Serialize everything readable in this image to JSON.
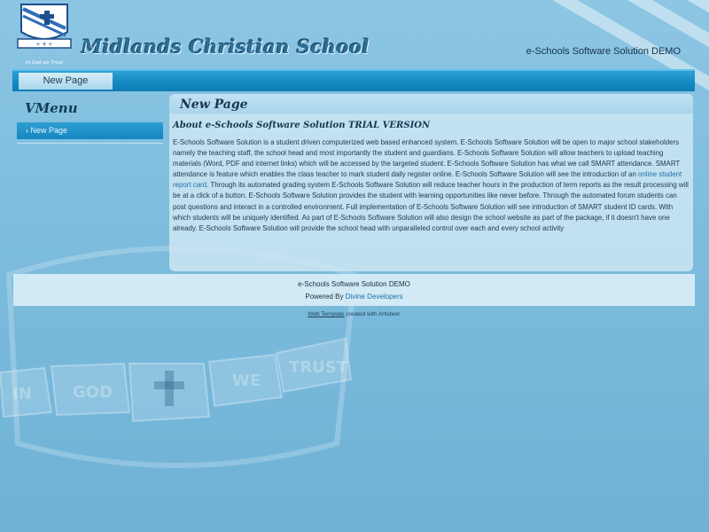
{
  "header": {
    "logo_motto": "In God we Trust",
    "site_title": "Midlands Christian School",
    "right_text": "e-Schools Software Solution DEMO"
  },
  "menubar": {
    "items": [
      {
        "label": "New Page"
      }
    ]
  },
  "vmenu": {
    "title": "VMenu",
    "items": [
      {
        "label": "New Page"
      }
    ]
  },
  "content": {
    "title": "New Page",
    "heading": "About e-Schools Software Solution TRIAL VERSION",
    "text_before_link": "E-Schools Software Solution is a student driven computerized web based enhanced system. E-Schools Software Solution will be open to major school stakeholders namely the teaching staff, the school head and most importantly the student and guardians. E-Schools Software Solution will allow teachers to upload teaching materials (Word, PDF and internet links) which will be accessed by the targeted student. E-Schools Software Solution has what we call SMART attendance. SMART attendance is feature which enables the class teacher to mark student daily register online. E-Schools Software Solution will see the introduction of an ",
    "link_text": "online student report card",
    "text_after_link": ". Through its automated grading system E-Schools Software Solution will reduce teacher hours in the production of term reports as the result processing will be at a click of a button. E-Schools Software Solution provides the student with learning opportunities like never before. Through the automated forum students can post questions and interact in a controlled environment. Full implementation of E-Schools Software Solution will see introduction of SMART student ID cards. With which students will be uniquely identified. As part of E-Schools Software Solution will also design the school website as part of the package, if it doesn't have one  already. E-Schools Software Solution will provide the school head with unparalleled control over each and every school activity"
  },
  "footer": {
    "line1": "e-Schools Software Solution DEMO",
    "powered_prefix": "Powered By ",
    "powered_link": "Divine Developers"
  },
  "credit": {
    "link": "Web Template",
    "suffix": " created with Artisteer."
  },
  "colors": {
    "background": "#7dbcdd",
    "menubar": "#138ac3",
    "link": "#1f6ea6",
    "title": "#2b6f96"
  }
}
